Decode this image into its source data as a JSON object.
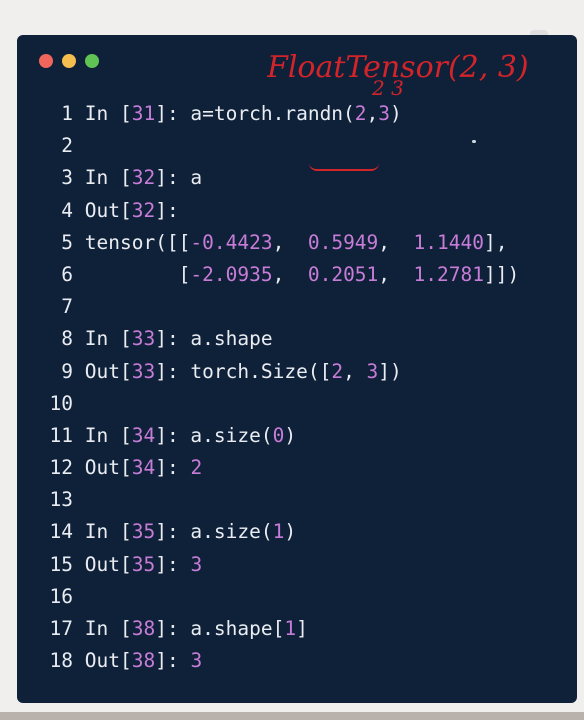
{
  "window": {
    "buttons": [
      "close",
      "minimize",
      "zoom"
    ],
    "colors": {
      "background": "#0f2039",
      "text": "#e9edf2",
      "number": "#c77dd7",
      "annotation": "#d3242a"
    }
  },
  "annotation": {
    "text": "FloatTensor(2, 3)",
    "subtext": "2 3"
  },
  "code_lines": [
    {
      "n": "1",
      "parts": [
        [
          "t",
          "In ["
        ],
        [
          "n",
          "31"
        ],
        [
          "t",
          "]: a=torch.randn("
        ],
        [
          "n",
          "2"
        ],
        [
          "t",
          ","
        ],
        [
          "n",
          "3"
        ],
        [
          "t",
          ")"
        ]
      ]
    },
    {
      "n": "2",
      "parts": []
    },
    {
      "n": "3",
      "parts": [
        [
          "t",
          "In ["
        ],
        [
          "n",
          "32"
        ],
        [
          "t",
          "]: a"
        ]
      ]
    },
    {
      "n": "4",
      "parts": [
        [
          "t",
          "Out["
        ],
        [
          "n",
          "32"
        ],
        [
          "t",
          "]:"
        ]
      ]
    },
    {
      "n": "5",
      "parts": [
        [
          "t",
          "tensor([["
        ],
        [
          "n",
          "-0.4423"
        ],
        [
          "t",
          ",  "
        ],
        [
          "n",
          "0.5949"
        ],
        [
          "t",
          ",  "
        ],
        [
          "n",
          "1.1440"
        ],
        [
          "t",
          "],"
        ]
      ]
    },
    {
      "n": "6",
      "parts": [
        [
          "t",
          "        ["
        ],
        [
          "n",
          "-2.0935"
        ],
        [
          "t",
          ",  "
        ],
        [
          "n",
          "0.2051"
        ],
        [
          "t",
          ",  "
        ],
        [
          "n",
          "1.2781"
        ],
        [
          "t",
          "]])"
        ]
      ]
    },
    {
      "n": "7",
      "parts": []
    },
    {
      "n": "8",
      "parts": [
        [
          "t",
          "In ["
        ],
        [
          "n",
          "33"
        ],
        [
          "t",
          "]: a.shape"
        ]
      ]
    },
    {
      "n": "9",
      "parts": [
        [
          "t",
          "Out["
        ],
        [
          "n",
          "33"
        ],
        [
          "t",
          "]: torch.Size(["
        ],
        [
          "n",
          "2"
        ],
        [
          "t",
          ", "
        ],
        [
          "n",
          "3"
        ],
        [
          "t",
          "])"
        ]
      ]
    },
    {
      "n": "10",
      "parts": []
    },
    {
      "n": "11",
      "parts": [
        [
          "t",
          "In ["
        ],
        [
          "n",
          "34"
        ],
        [
          "t",
          "]: a.size("
        ],
        [
          "n",
          "0"
        ],
        [
          "t",
          ")"
        ]
      ]
    },
    {
      "n": "12",
      "parts": [
        [
          "t",
          "Out["
        ],
        [
          "n",
          "34"
        ],
        [
          "t",
          "]: "
        ],
        [
          "n",
          "2"
        ]
      ]
    },
    {
      "n": "13",
      "parts": []
    },
    {
      "n": "14",
      "parts": [
        [
          "t",
          "In ["
        ],
        [
          "n",
          "35"
        ],
        [
          "t",
          "]: a.size("
        ],
        [
          "n",
          "1"
        ],
        [
          "t",
          ")"
        ]
      ]
    },
    {
      "n": "15",
      "parts": [
        [
          "t",
          "Out["
        ],
        [
          "n",
          "35"
        ],
        [
          "t",
          "]: "
        ],
        [
          "n",
          "3"
        ]
      ]
    },
    {
      "n": "16",
      "parts": []
    },
    {
      "n": "17",
      "parts": [
        [
          "t",
          "In ["
        ],
        [
          "n",
          "38"
        ],
        [
          "t",
          "]: a.shape["
        ],
        [
          "n",
          "1"
        ],
        [
          "t",
          "]"
        ]
      ]
    },
    {
      "n": "18",
      "parts": [
        [
          "t",
          "Out["
        ],
        [
          "n",
          "38"
        ],
        [
          "t",
          "]: "
        ],
        [
          "n",
          "3"
        ]
      ]
    }
  ]
}
